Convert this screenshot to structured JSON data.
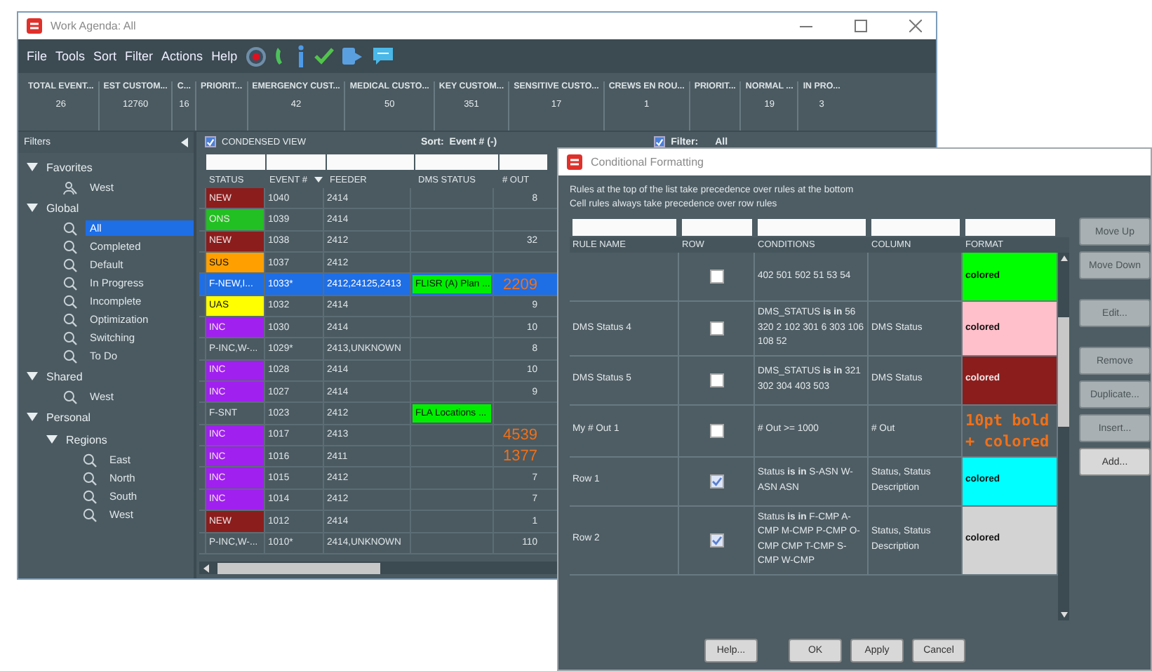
{
  "main_window": {
    "title": "Work Agenda:  All",
    "menu": [
      "File",
      "Tools",
      "Sort",
      "Filter",
      "Actions",
      "Help"
    ],
    "summary": [
      {
        "label": "TOTAL EVENT...",
        "value": "26"
      },
      {
        "label": "EST CUSTOM...",
        "value": "12760"
      },
      {
        "label": "C...",
        "value": "16"
      },
      {
        "label": "PRIORIT..."
      },
      {
        "label": "EMERGENCY CUST...",
        "value": "42"
      },
      {
        "label": "MEDICAL CUSTO...",
        "value": "50"
      },
      {
        "label": "KEY CUSTOM...",
        "value": "351"
      },
      {
        "label": "SENSITIVE CUSTO...",
        "value": "17"
      },
      {
        "label": "CREWS EN ROU...",
        "value": "1"
      },
      {
        "label": "PRIORIT..."
      },
      {
        "label": "NORMAL ...",
        "value": "19"
      },
      {
        "label": "IN PRO...",
        "value": "3"
      }
    ],
    "sidebar": {
      "title": "Filters",
      "tree": [
        {
          "label": "Favorites",
          "expanded": true,
          "children": [
            {
              "label": "West",
              "kind": "favorite",
              "selected": false
            }
          ]
        },
        {
          "label": "Global",
          "expanded": true,
          "children": [
            {
              "label": "All",
              "kind": "filter",
              "selected": true
            },
            {
              "label": "Completed",
              "kind": "filter",
              "selected": false
            },
            {
              "label": "Default",
              "kind": "filter",
              "selected": false
            },
            {
              "label": "In Progress",
              "kind": "filter",
              "selected": false
            },
            {
              "label": "Incomplete",
              "kind": "filter",
              "selected": false
            },
            {
              "label": "Optimization",
              "kind": "filter",
              "selected": false
            },
            {
              "label": "Switching",
              "kind": "filter",
              "selected": false
            },
            {
              "label": "To Do",
              "kind": "filter",
              "selected": false
            }
          ]
        },
        {
          "label": "Shared",
          "expanded": true,
          "children": [
            {
              "label": "West",
              "kind": "filter",
              "selected": false
            }
          ]
        },
        {
          "label": "Personal",
          "expanded": true,
          "children": [
            {
              "label": "Regions",
              "expanded": true,
              "children": [
                {
                  "label": "East",
                  "kind": "filter",
                  "selected": false
                },
                {
                  "label": "North",
                  "kind": "filter",
                  "selected": false
                },
                {
                  "label": "South",
                  "kind": "filter",
                  "selected": false
                },
                {
                  "label": "West",
                  "kind": "filter",
                  "selected": false
                }
              ]
            }
          ]
        }
      ]
    },
    "toolbar": {
      "condensed_view": {
        "label": "CONDENSED VIEW",
        "checked": true
      },
      "sort_label": "Sort:",
      "sort_value": "Event # (-)",
      "filter": {
        "label": "Filter:",
        "value": "All",
        "checked": true
      }
    },
    "table": {
      "columns": [
        {
          "label": "STATUS",
          "sorted": false
        },
        {
          "label": "EVENT #",
          "sorted": true
        },
        {
          "label": "FEEDER",
          "sorted": false
        },
        {
          "label": "DMS STATUS",
          "sorted": false
        },
        {
          "label": "# OUT",
          "sorted": false
        }
      ],
      "rows": [
        {
          "status": {
            "text": "NEW",
            "color": "#8b1d1d"
          },
          "event": "1040",
          "feeder": "2414",
          "out": {
            "text": "8",
            "alert": false
          },
          "selected": false
        },
        {
          "status": {
            "text": "ONS",
            "color": "#22c022"
          },
          "event": "1039",
          "feeder": "2414",
          "selected": false
        },
        {
          "status": {
            "text": "NEW",
            "color": "#8b1d1d"
          },
          "event": "1038",
          "feeder": "2412",
          "out": {
            "text": "32",
            "alert": false
          },
          "selected": false
        },
        {
          "status": {
            "text": "SUS",
            "color": "#ffa000"
          },
          "event": "1037",
          "feeder": "2412",
          "selected": false
        },
        {
          "status": {
            "text": "F-NEW,I..."
          },
          "event": "1033*",
          "feeder": "2412,24125,2413",
          "dms_status": {
            "text": "FLISR (A) Plan ...",
            "color": "#00ee00"
          },
          "out": {
            "text": "2209",
            "alert": true
          },
          "selected": true
        },
        {
          "status": {
            "text": "UAS",
            "color": "#ffff00"
          },
          "event": "1032",
          "feeder": "2414",
          "out": {
            "text": "9",
            "alert": false
          },
          "selected": false
        },
        {
          "status": {
            "text": "INC",
            "color": "#a020f0"
          },
          "event": "1030",
          "feeder": "2414",
          "out": {
            "text": "10",
            "alert": false
          },
          "selected": false
        },
        {
          "status": {
            "text": "P-INC,W-..."
          },
          "event": "1029*",
          "feeder": "2413,UNKNOWN",
          "out": {
            "text": "8",
            "alert": false
          },
          "selected": false
        },
        {
          "status": {
            "text": "INC",
            "color": "#a020f0"
          },
          "event": "1028",
          "feeder": "2414",
          "out": {
            "text": "10",
            "alert": false
          },
          "selected": false
        },
        {
          "status": {
            "text": "INC",
            "color": "#a020f0"
          },
          "event": "1027",
          "feeder": "2414",
          "out": {
            "text": "9",
            "alert": false
          },
          "selected": false
        },
        {
          "status": {
            "text": "F-SNT"
          },
          "event": "1023",
          "feeder": "2412",
          "dms_status": {
            "text": "FLA Locations ...",
            "color": "#00ee00"
          },
          "selected": false
        },
        {
          "status": {
            "text": "INC",
            "color": "#a020f0"
          },
          "event": "1017",
          "feeder": "2413",
          "out": {
            "text": "4539",
            "alert": true
          },
          "selected": false
        },
        {
          "status": {
            "text": "INC",
            "color": "#a020f0"
          },
          "event": "1016",
          "feeder": "2411",
          "out": {
            "text": "1377",
            "alert": true
          },
          "selected": false
        },
        {
          "status": {
            "text": "INC",
            "color": "#a020f0"
          },
          "event": "1015",
          "feeder": "2412",
          "out": {
            "text": "7",
            "alert": false
          },
          "selected": false
        },
        {
          "status": {
            "text": "INC",
            "color": "#a020f0"
          },
          "event": "1014",
          "feeder": "2412",
          "out": {
            "text": "7",
            "alert": false
          },
          "selected": false
        },
        {
          "status": {
            "text": "NEW",
            "color": "#8b1d1d"
          },
          "event": "1012",
          "feeder": "2414",
          "out": {
            "text": "1",
            "alert": false
          },
          "selected": false
        },
        {
          "status": {
            "text": "P-INC,W-..."
          },
          "event": "1010*",
          "feeder": "2414,UNKNOWN",
          "out": {
            "text": "110",
            "alert": false
          },
          "selected": false
        }
      ]
    }
  },
  "dialog": {
    "title": "Conditional Formatting",
    "notes": [
      "Rules at the top of the list take precedence over rules at the bottom",
      "Cell rules always take precedence over row rules"
    ],
    "columns": [
      "RULE NAME",
      "ROW",
      "CONDITIONS",
      "COLUMN",
      "FORMAT"
    ],
    "rules": [
      {
        "row": false,
        "conditions": "402 501 502 51 53 54",
        "format": {
          "kind": "fill",
          "text": "colored",
          "color": "#00ff00"
        }
      },
      {
        "name": "DMS Status 4",
        "row": false,
        "conditions": "DMS_STATUS **is** **in** 56 320 2 102 301 6 303 106 108 52",
        "column": "DMS Status",
        "format": {
          "kind": "fill",
          "text": "colored",
          "color": "#ffc0cb"
        }
      },
      {
        "name": "DMS Status 5",
        "row": false,
        "conditions": "DMS_STATUS **is** **in** 321 302 304 403 503",
        "column": "DMS Status",
        "format": {
          "kind": "fill",
          "text": "colored",
          "color": "#8b1d1d"
        }
      },
      {
        "name": "My # Out 1",
        "row": false,
        "conditions": "# Out >= 1000",
        "column": "# Out",
        "format": {
          "kind": "text",
          "text": "10pt bold + colored",
          "color": "#f07018"
        }
      },
      {
        "name": "Row 1",
        "row": true,
        "conditions": "Status **is** **in** S-ASN W-ASN ASN",
        "column": "Status, Status Description",
        "format": {
          "kind": "fill",
          "text": "colored",
          "color": "#00ffff"
        }
      },
      {
        "name": "Row 2",
        "row": true,
        "conditions": "Status **is** **in** F-CMP A-CMP M-CMP P-CMP O-CMP CMP T-CMP S-CMP W-CMP",
        "column": "Status, Status Description",
        "format": {
          "kind": "fill",
          "text": "colored",
          "color": "#d3d3d3"
        }
      }
    ],
    "side_button_groups": [
      [
        {
          "label": "Move Up",
          "disabled": true
        },
        {
          "label": "Move Down",
          "disabled": true
        }
      ],
      [
        {
          "label": "Edit...",
          "disabled": true
        }
      ],
      [
        {
          "label": "Remove",
          "disabled": true
        },
        {
          "label": "Duplicate...",
          "disabled": true
        },
        {
          "label": "Insert...",
          "disabled": true
        },
        {
          "label": "Add...",
          "disabled": false
        }
      ]
    ],
    "buttons": [
      "Help...",
      "OK",
      "Apply",
      "Cancel"
    ]
  }
}
